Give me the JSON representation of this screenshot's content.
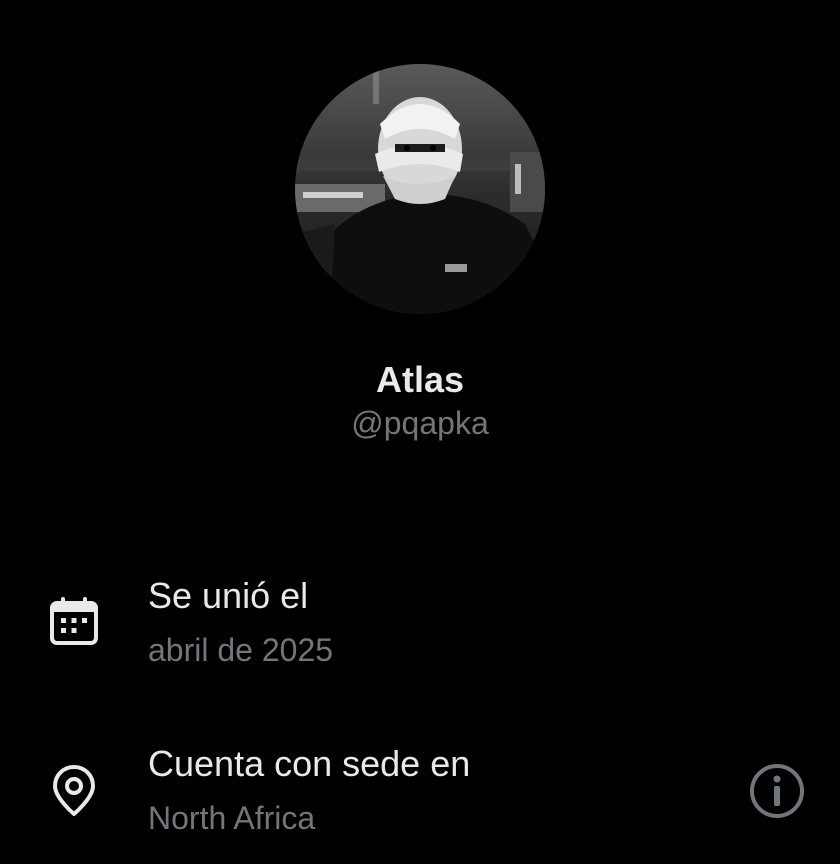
{
  "profile": {
    "display_name": "Atlas",
    "handle": "@pqapka",
    "avatar_icon": "profile-photo"
  },
  "about": {
    "joined": {
      "title": "Se unió el",
      "value": "abril de 2025",
      "icon": "calendar-icon"
    },
    "location": {
      "title": "Cuenta con sede en",
      "value": "North Africa",
      "icon": "location-pin-icon",
      "info_icon": "info-icon"
    }
  },
  "colors": {
    "background": "#000000",
    "primary_text": "#e7e9ea",
    "secondary_text": "#71767b"
  }
}
